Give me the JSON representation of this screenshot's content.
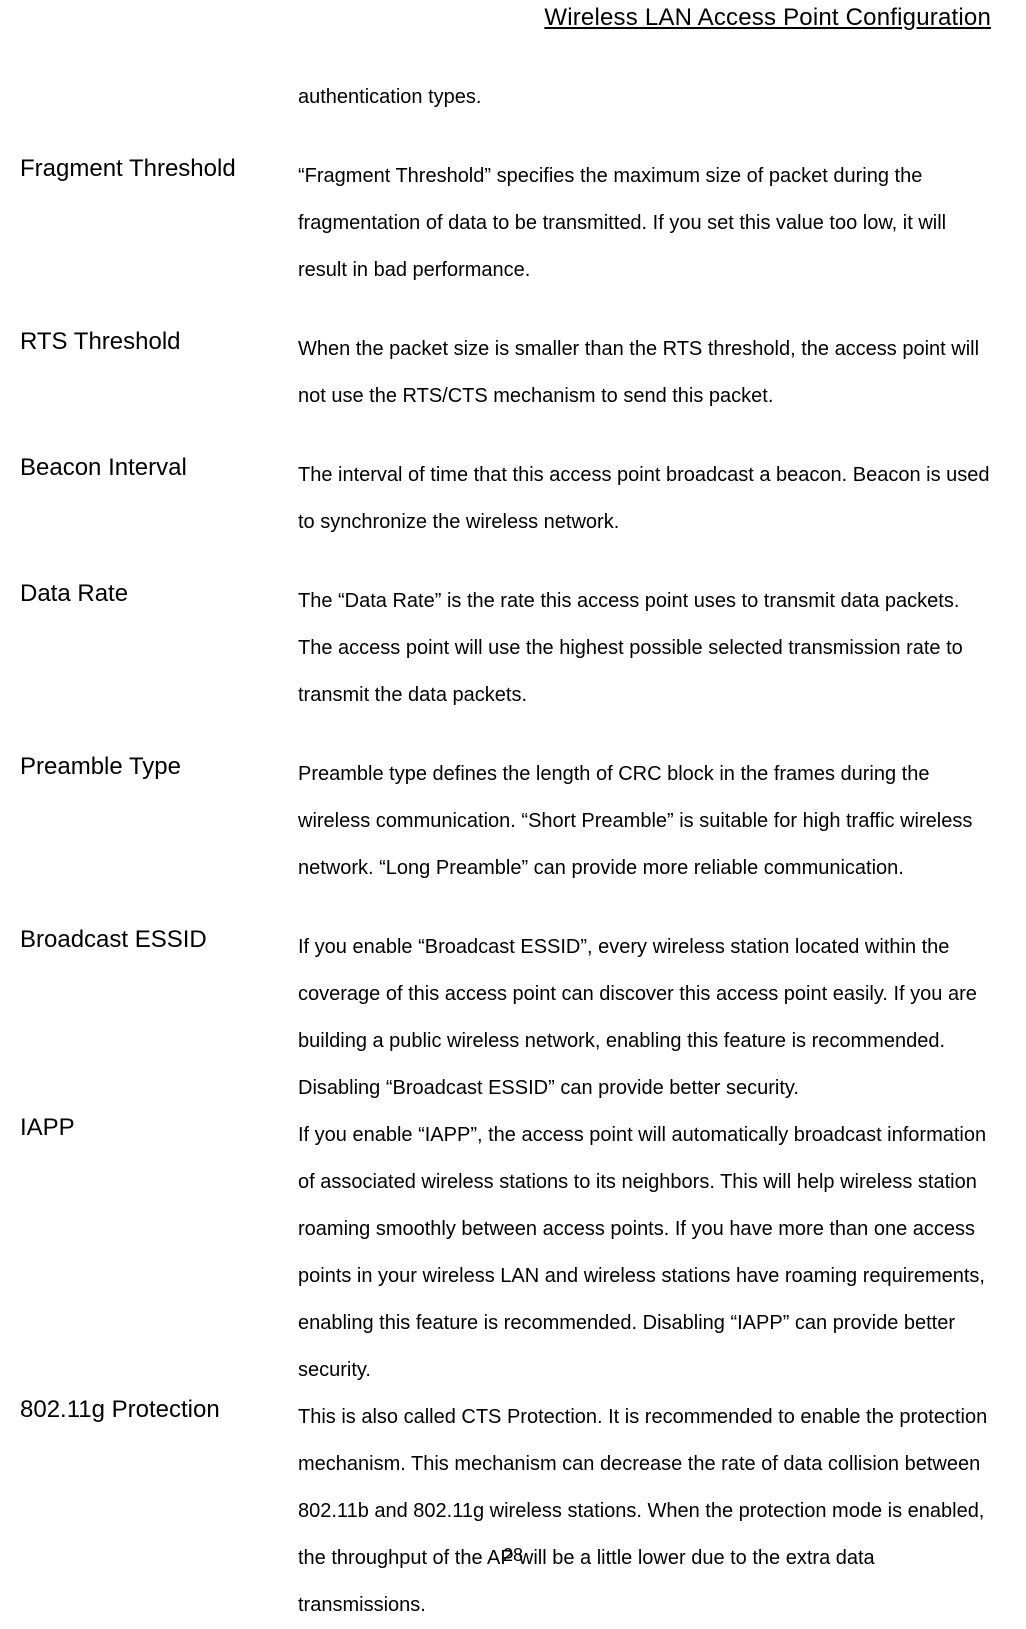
{
  "header": "Wireless LAN Access Point Configuration",
  "page_number": "28",
  "top_fragment": "authentication types.",
  "rows": [
    {
      "label": "Fragment Threshold",
      "desc": "“Fragment Threshold” specifies the maximum size of packet during the fragmentation of data to be transmitted. If you set this value too low, it will result in bad performance."
    },
    {
      "label": "RTS Threshold",
      "desc": "When the packet size is smaller than the RTS threshold, the access point will not use the RTS/CTS mechanism to send this packet."
    },
    {
      "label": "Beacon Interval",
      "desc": "The interval of time that this access point broadcast a beacon. Beacon is used to synchronize the wireless network."
    },
    {
      "label": "Data Rate",
      "desc": "The “Data Rate” is the rate this access point uses to transmit data packets. The access point will use the highest possible selected transmission rate to transmit the data packets."
    },
    {
      "label": "Preamble Type",
      "desc": "Preamble type defines the length of CRC block in the frames during the wireless communication. “Short Preamble” is suitable for high traffic wireless network. “Long Preamble” can provide more reliable communication."
    },
    {
      "label": "Broadcast ESSID",
      "desc": "If you enable “Broadcast ESSID”, every wireless station located within the coverage of this access point can discover this access point easily. If you are building a public wireless network, enabling this feature is recommended. Disabling “Broadcast ESSID” can provide better security."
    },
    {
      "label": "IAPP",
      "desc": "If you enable “IAPP”, the access point will automatically broadcast information of associated wireless stations to its neighbors. This will help wireless station roaming smoothly between access points. If you have more than one access points in your wireless LAN and wireless stations have roaming requirements, enabling this feature is recommended. Disabling “IAPP” can provide better security."
    },
    {
      "label": "802.11g Protection",
      "desc": "This is also called CTS Protection. It is recommended to enable the protection mechanism. This mechanism can decrease the rate of data collision between 802.11b and 802.11g wireless stations. When the protection mode is enabled, the throughput of the AP will be a little lower due to the extra data transmissions."
    }
  ]
}
